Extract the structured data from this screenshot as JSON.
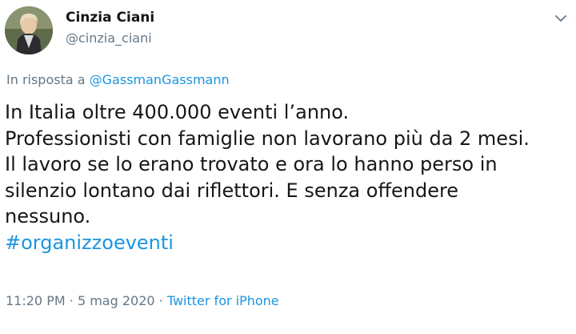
{
  "author": {
    "display_name": "Cinzia Ciani",
    "handle": "@cinzia_ciani"
  },
  "reply": {
    "prefix": "In risposta a",
    "target": "@GassmanGassmann"
  },
  "tweet": {
    "lines": [
      "In Italia oltre 400.000 eventi l’anno.",
      "Professionisti con famiglie non lavorano più da 2 mesi.",
      "Il lavoro se lo erano trovato e ora lo hanno perso in",
      "silenzio lontano dai riflettori. E senza offendere",
      "nessuno."
    ],
    "hashtag": "#organizzoeventi"
  },
  "meta": {
    "time": "11:20 PM",
    "separator": "·",
    "date": "5 mag 2020",
    "source": "Twitter for iPhone"
  },
  "icons": {
    "menu": "chevron-down-icon"
  },
  "colors": {
    "link": "#1b95e0",
    "secondary_text": "#657786",
    "primary_text": "#14171a"
  }
}
